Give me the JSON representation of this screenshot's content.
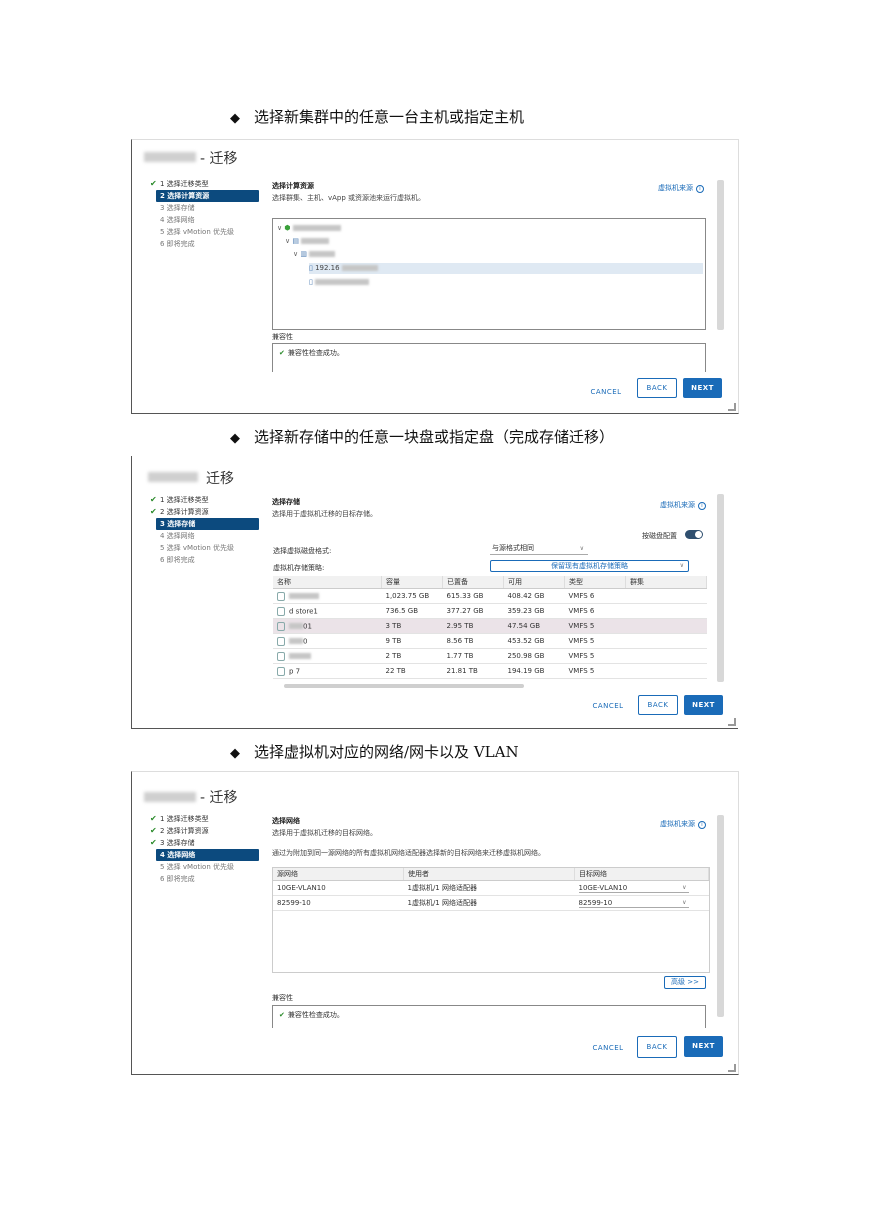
{
  "headings": [
    "选择新集群中的任意一台主机或指定主机",
    "选择新存储中的任意一块盘或指定盘（完成存储迁移）",
    "选择虚拟机对应的网络/网卡以及 VLAN"
  ],
  "diamond": "◆",
  "dialog_title": "- 迁移",
  "dialog_title2": "迁移",
  "buttons": {
    "cancel": "CANCEL",
    "back": "BACK",
    "next": "NEXT"
  },
  "help_link": "虚拟机来源",
  "steps": {
    "s1": [
      "1 选择迁移类型",
      "2 选择计算资源",
      "3 选择存储",
      "4 选择网络",
      "5 选择 vMotion 优先级",
      "6 即将完成"
    ],
    "s2": [
      "1 选择迁移类型",
      "2 选择计算资源",
      "3 选择存储",
      "4 选择网络",
      "5 选择 vMotion 优先级",
      "6 即将完成"
    ],
    "s3": [
      "1 选择迁移类型",
      "2 选择计算资源",
      "3 选择存储",
      "4 选择网络",
      "5 选择 vMotion 优先级",
      "6 即将完成"
    ]
  },
  "shot1": {
    "title": "选择计算资源",
    "subtitle": "选择群集、主机、vApp 或资源池来运行虚拟机。",
    "host_ip": "192.16",
    "compat_label": "兼容性",
    "compat_msg": "兼容性检查成功。"
  },
  "shot2": {
    "title": "选择存储",
    "subtitle": "选择用于虚拟机迁移的目标存储。",
    "per_disk": "按磁盘配置",
    "disk_format_label": "选择虚拟磁盘格式:",
    "disk_format_value": "与源格式相同",
    "policy_label": "虚拟机存储策略:",
    "policy_value": "保留现有虚拟机存储策略",
    "columns": [
      "名称",
      "容量",
      "已置备",
      "可用",
      "类型",
      "群集"
    ],
    "rows": [
      [
        "",
        "1,023.75 GB",
        "615.33 GB",
        "408.42 GB",
        "VMFS 6",
        ""
      ],
      [
        "d store1",
        "736.5 GB",
        "377.27 GB",
        "359.23 GB",
        "VMFS 6",
        ""
      ],
      [
        "01",
        "3 TB",
        "2.95 TB",
        "47.54 GB",
        "VMFS 5",
        ""
      ],
      [
        "0",
        "9 TB",
        "8.56 TB",
        "453.52 GB",
        "VMFS 5",
        ""
      ],
      [
        "",
        "2 TB",
        "1.77 TB",
        "250.98 GB",
        "VMFS 5",
        ""
      ],
      [
        "p 7",
        "22 TB",
        "21.81 TB",
        "194.19 GB",
        "VMFS 5",
        ""
      ]
    ]
  },
  "shot3": {
    "title": "选择网络",
    "subtitle": "选择用于虚拟机迁移的目标网络。",
    "desc": "通过为附加到同一源网络的所有虚拟机网络适配器选择新的目标网络来迁移虚拟机网络。",
    "columns": [
      "源网络",
      "使用者",
      "目标网络"
    ],
    "rows": [
      [
        "10GE-VLAN10",
        "1虚拟机/1 网络适配器",
        "10GE-VLAN10"
      ],
      [
        "82599-10",
        "1虚拟机/1 网络适配器",
        "82599-10"
      ]
    ],
    "advanced": "高级 >>",
    "compat_label": "兼容性",
    "compat_msg": "兼容性检查成功。"
  }
}
